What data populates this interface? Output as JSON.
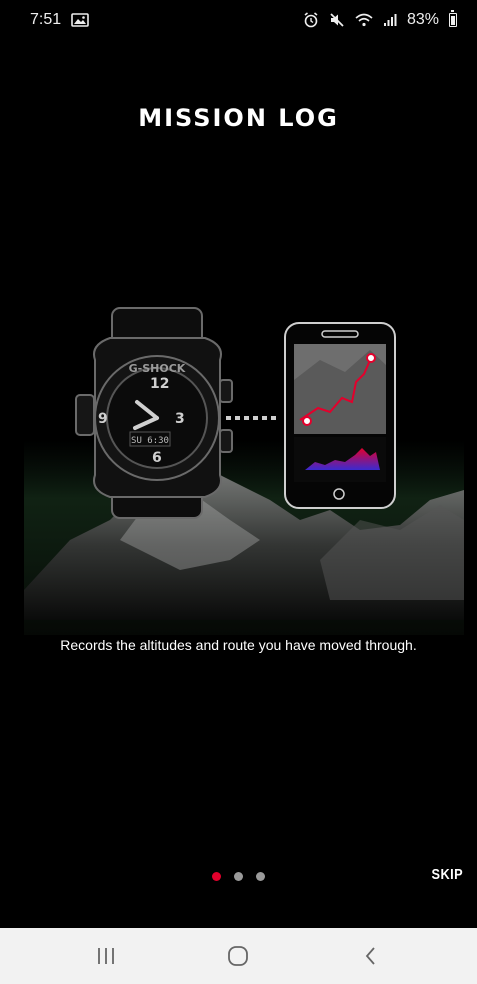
{
  "status_bar": {
    "time": "7:51",
    "battery_percent": "83%",
    "icons_left": [
      "gallery-icon"
    ],
    "icons_right": [
      "alarm-icon",
      "mute-icon",
      "wifi-icon",
      "signal-icon",
      "battery-icon"
    ]
  },
  "onboarding": {
    "title": "MISSION LOG",
    "caption": "Records the altitudes and route you have moved through.",
    "skip_label": "SKIP",
    "page_count": 3,
    "current_page": 1,
    "watch_brand": "G-SHOCK",
    "watch_display": "SU 6:30",
    "accent_color": "#e3002c"
  },
  "nav_bar": {
    "buttons": [
      "recent-apps",
      "home",
      "back"
    ]
  }
}
